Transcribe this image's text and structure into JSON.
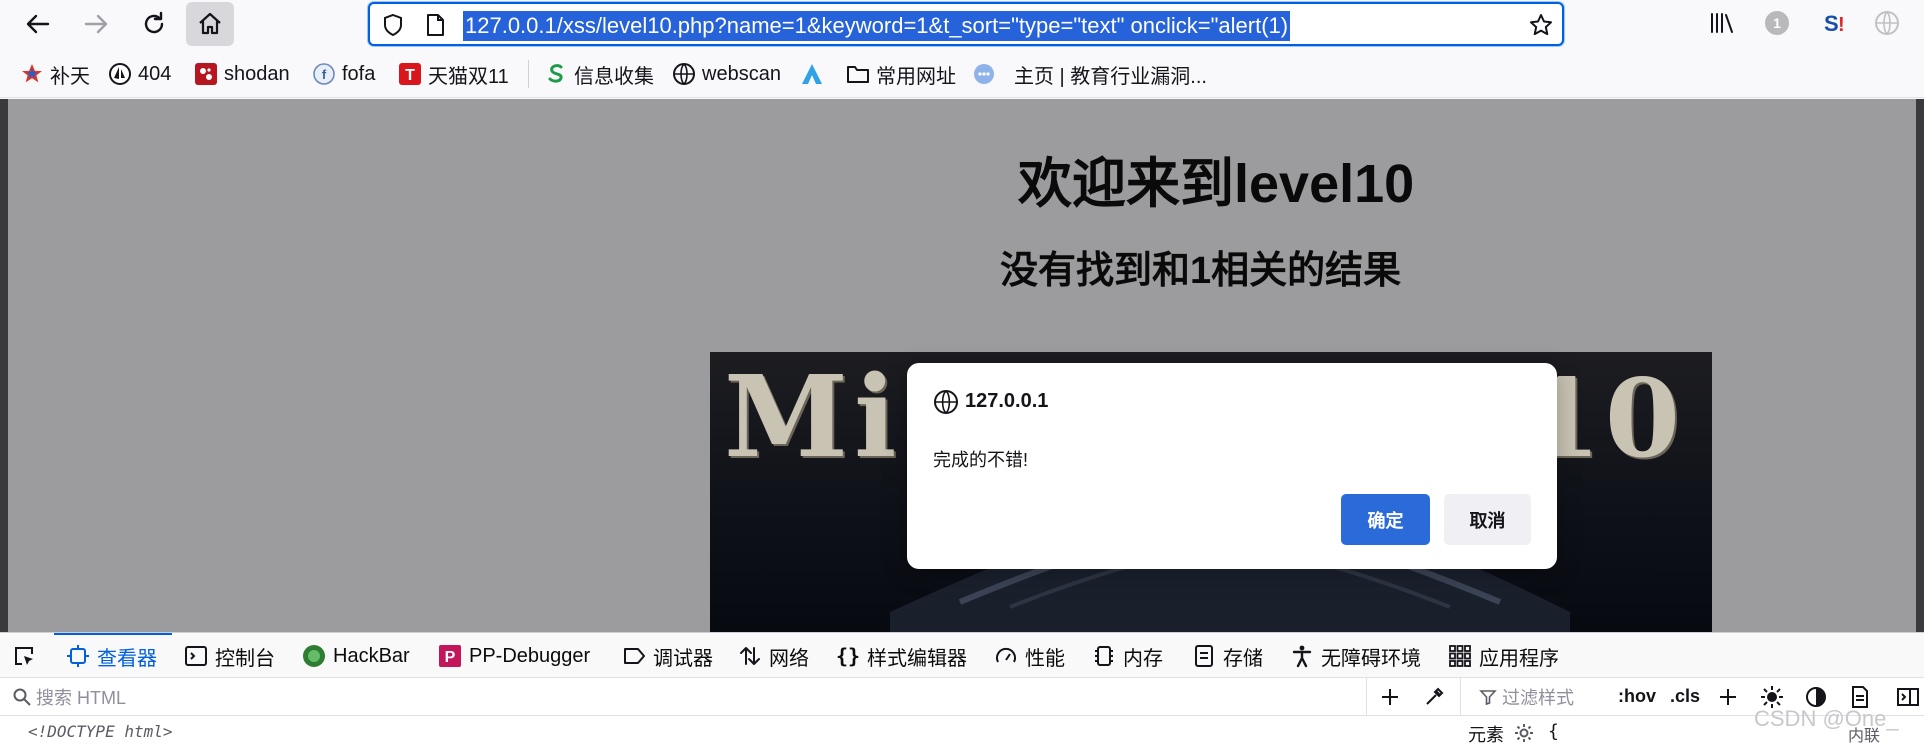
{
  "browser": {
    "url": "127.0.0.1/xss/level10.php?name=1&keyword=1&t_sort=\"type=\"text\" onclick=\"alert(1)",
    "extension_badge": "1"
  },
  "bookmarks": [
    {
      "label": "补天",
      "icon": "star-logo-icon"
    },
    {
      "label": "404",
      "icon": "sailboat-icon"
    },
    {
      "label": "shodan",
      "icon": "shodan-icon"
    },
    {
      "label": "fofa",
      "icon": "fofa-icon"
    },
    {
      "label": "天猫双11",
      "icon": "tmall-icon"
    },
    {
      "label": "信息收集",
      "icon": "s-logo-icon"
    },
    {
      "label": "webscan",
      "icon": "globe-icon"
    },
    {
      "label": "",
      "icon": "triangle-logo-icon"
    },
    {
      "label": "常用网址",
      "icon": "folder-icon"
    },
    {
      "label": "",
      "icon": "dots-logo-icon"
    },
    {
      "label": "主页 | 教育行业漏洞...",
      "icon": ""
    }
  ],
  "page": {
    "heading": "欢迎来到level10",
    "subheading": "没有找到和1相关的结果",
    "banner_left": "Mis",
    "banner_right": "10"
  },
  "dialog": {
    "origin": "127.0.0.1",
    "message": "完成的不错!",
    "ok": "确定",
    "cancel": "取消"
  },
  "devtools": {
    "tabs": [
      {
        "label": "查看器",
        "icon": "inspector-icon",
        "active": true
      },
      {
        "label": "控制台",
        "icon": "console-icon"
      },
      {
        "label": "HackBar",
        "icon": "hackbar-icon"
      },
      {
        "label": "PP-Debugger",
        "icon": "pp-debugger-icon"
      },
      {
        "label": "调试器",
        "icon": "debugger-icon"
      },
      {
        "label": "网络",
        "icon": "network-icon"
      },
      {
        "label": "样式编辑器",
        "icon": "style-editor-icon"
      },
      {
        "label": "性能",
        "icon": "performance-icon"
      },
      {
        "label": "内存",
        "icon": "memory-icon"
      },
      {
        "label": "存储",
        "icon": "storage-icon"
      },
      {
        "label": "无障碍环境",
        "icon": "accessibility-icon"
      },
      {
        "label": "应用程序",
        "icon": "application-icon"
      }
    ],
    "search_placeholder": "搜索 HTML",
    "filter_placeholder": "过滤样式",
    "hov": ":hov",
    "cls": ".cls",
    "doctype": "<!DOCTYPE html>",
    "element_label": "元素",
    "brace": "{",
    "inline_label": "内联"
  },
  "watermark": "CSDN @One_"
}
